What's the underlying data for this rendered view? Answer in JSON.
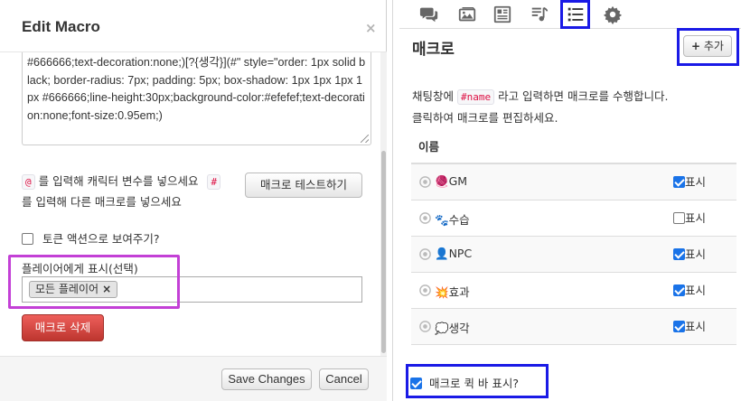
{
  "dialog": {
    "title": "Edit Macro",
    "close_label": "×",
    "macro_text": "#666666;text-decoration:none;)[?{생각}](#\" style=\"order: 1px solid black; border-radius: 7px; padding: 5px; box-shadow: 1px 1px 1px 1px #666666;line-height:30px;background-color:#efefef;text-decoration:none;font-size:0.95em;)",
    "help": {
      "at_symbol": "@",
      "line1_rest": " 를 입력해 캐릭터 변수를 넣으세요",
      "hash_symbol": "#",
      "line2": "를 입력해 다른 매크로를 넣으세요"
    },
    "test_button": "매크로 테스트하기",
    "token_action_label": "토큰 액션으로 보여주기?",
    "token_action_checked": false,
    "viewers_label": "플레이어에게 표시(선택)",
    "viewers_tag": "모든 플레이어",
    "viewers_tag_remove": "×",
    "delete_button": "매크로 삭제",
    "save_button": "Save Changes",
    "cancel_button": "Cancel"
  },
  "panel": {
    "tabs": [
      {
        "icon": "chat-bubbles-icon"
      },
      {
        "icon": "image-gallery-icon"
      },
      {
        "icon": "journal-icon"
      },
      {
        "icon": "music-playlist-icon"
      },
      {
        "icon": "list-icon",
        "active": true
      },
      {
        "icon": "gear-icon"
      }
    ],
    "title": "매크로",
    "add_button_plus": "+",
    "add_button": "추가",
    "desc_before": "채팅창에 ",
    "desc_code": "#name",
    "desc_after": " 라고 입력하면 매크로를 수행합니다.",
    "desc_line2": "클릭하여 매크로를 편집하세요.",
    "table": {
      "header": "이름",
      "show_label": "표시",
      "rows": [
        {
          "emoji": "🧶",
          "name": "GM",
          "show": true
        },
        {
          "emoji": "🐾",
          "name": "수습",
          "show": false
        },
        {
          "emoji": "👤",
          "name": "NPC",
          "show": true
        },
        {
          "emoji": "💥",
          "name": "효과",
          "show": true
        },
        {
          "emoji": "💭",
          "name": "생각",
          "show": true
        }
      ]
    },
    "quickbar_label": "매크로 퀵 바 표시?",
    "quickbar_checked": true
  },
  "colors": {
    "highlight_purple": "#c340d6",
    "highlight_blue": "#1a1ae6",
    "delete_red": "#da4f49",
    "checkbox_blue": "#1a73e8"
  }
}
